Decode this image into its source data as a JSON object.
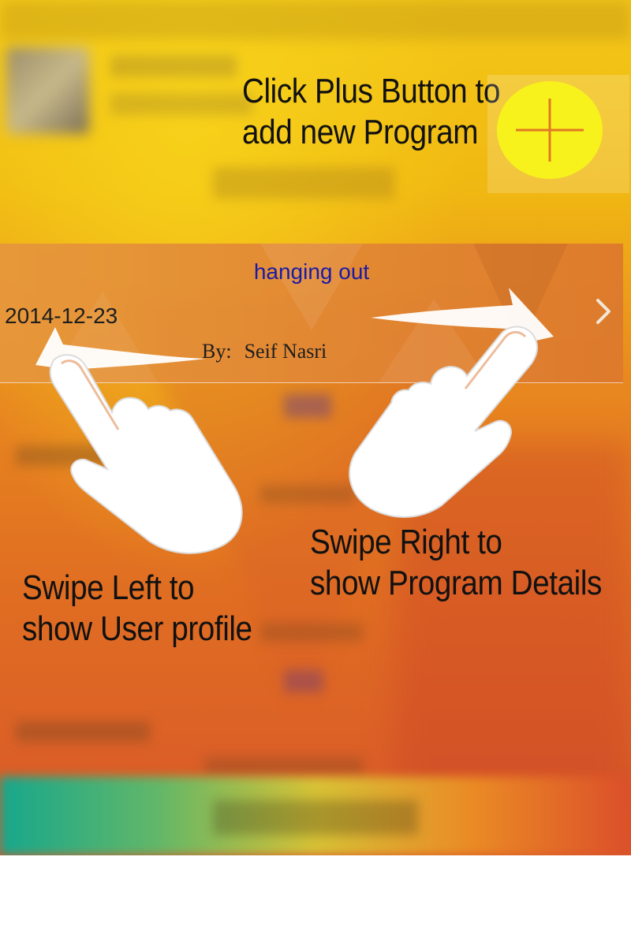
{
  "tutorial": {
    "plus_hint_line1": "Click Plus Button to",
    "plus_hint_line2": "add new Program",
    "swipe_left_line1": "Swipe Left to",
    "swipe_left_line2": "show User profile",
    "swipe_right_line1": "Swipe Right to",
    "swipe_right_line2": "show Program Details"
  },
  "program_cell": {
    "title": "hanging out",
    "date": "2014-12-23",
    "by_label": "By:",
    "author": "Seif Nasri"
  },
  "colors": {
    "title": "#1a1aa8",
    "plus_button": "#f8f21c",
    "plus_sign": "#e07a24"
  },
  "icons": {
    "plus": "plus-icon",
    "chevron": "chevron-right-icon",
    "swipe_left": "swipe-left-hand-icon",
    "swipe_right": "swipe-right-hand-icon"
  }
}
